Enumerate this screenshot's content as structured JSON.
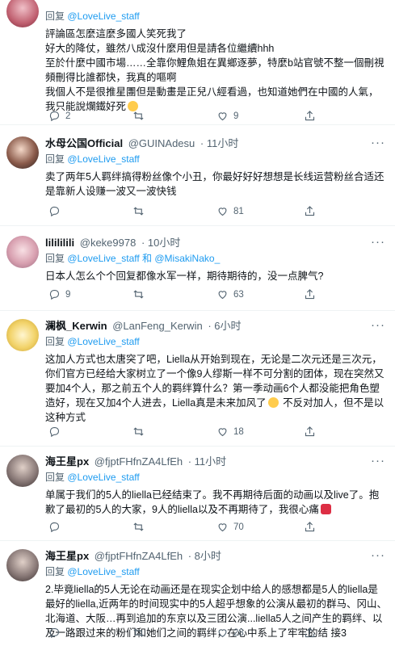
{
  "tweets": [
    {
      "name": "",
      "handle": "",
      "time": "",
      "reply_prefix": "回复",
      "reply_to": "@LoveLive_staff",
      "lines": [
        "評論區怎麼這麼多國人笑死我了",
        "好大的降仗，雖然八成沒什麼用但是請各位繼續hhh",
        "至於什麼中國市場……全靠你鯉魚姐在異鄉逐夢，特麼b站官號不整一個刪視頻刪得比誰都快，我真的嘔啊",
        "我個人不是很推星團但是動畫是正兒八經看過，也知道她們在中國的人氣，我只能說爛鐵好死"
      ],
      "counts": {
        "reply": "2",
        "retweet": "",
        "like": "9"
      }
    },
    {
      "name": "水母公国Official",
      "handle": "@GUINAdesu",
      "time": "· 11小时",
      "reply_prefix": "回复",
      "reply_to": "@LoveLive_staff",
      "lines": [
        "卖了两年5人羁绊搞得粉丝像个小丑，你最好好好想想是长线运营粉丝合适还是靠新人设赚一波又一波快钱"
      ],
      "counts": {
        "reply": "",
        "retweet": "",
        "like": "81"
      }
    },
    {
      "name": "lilililili",
      "handle": "@keke9978",
      "time": "· 10小时",
      "reply_prefix": "回复",
      "reply_to": "@LoveLive_staff 和 @MisakiNako_",
      "lines": [
        "日本人怎么个个回复都像水军一样，期待期待的，没一点脾气?"
      ],
      "counts": {
        "reply": "9",
        "retweet": "",
        "like": "63"
      }
    },
    {
      "name": "澜枫_Kerwin",
      "handle": "@LanFeng_Kerwin",
      "time": "· 6小时",
      "reply_prefix": "回复",
      "reply_to": "@LoveLive_staff",
      "lines": [
        "这加人方式也太唐突了吧，Liella从开始到现在，无论是二次元还是三次元，你们官方已经给大家树立了一个像9人缪斯一样不可分割的团体，现在突然又要加4个人，那之前五个人的羁绊算什么？第一季动画6个人都没能把角色塑造好，现在又加4个人进去，Liella真是未来加风了",
        " 不反对加人，但不是以这种方式"
      ],
      "counts": {
        "reply": "",
        "retweet": "",
        "like": "18"
      }
    },
    {
      "name": "海王星px",
      "handle": "@fjptFHfnZA4LfEh",
      "time": "· 11小时",
      "reply_prefix": "回复",
      "reply_to": "@LoveLive_staff",
      "lines": [
        "单属于我们的5人的liella已经结束了。我不再期待后面的动画以及live了。抱歉了最初的5人的大家，9人的liella以及不再期待了，我很心痛"
      ],
      "counts": {
        "reply": "",
        "retweet": "",
        "like": "70"
      }
    },
    {
      "name": "海王星px",
      "handle": "@fjptFHfnZA4LfEh",
      "time": "· 8小时",
      "reply_prefix": "回复",
      "reply_to": "@LoveLive_staff",
      "lines": [
        "2.毕竟liella的5人无论在动画还是在现实企划中给人的感想都是5人的liella是最好的liella,近两年的时间现实中的5人超乎想象的公演从最初的群马、冈山、北海道、大阪…再到追加的东京以及三团公演...liella5人之间产生的羁绊、以及一路跟过来的粉们和她们之间的羁绊，在心中系上了牢牢的结 接3"
      ],
      "counts": {
        "reply": "",
        "retweet": "",
        "like": "28"
      }
    }
  ],
  "icons": {
    "reply": "reply-icon",
    "retweet": "retweet-icon",
    "like": "heart-icon",
    "share": "share-icon",
    "more": "more-icon"
  },
  "colors": {
    "link": "#1d9bf0",
    "muted": "#536471",
    "text": "#0f1419",
    "divider": "#eff3f4"
  }
}
